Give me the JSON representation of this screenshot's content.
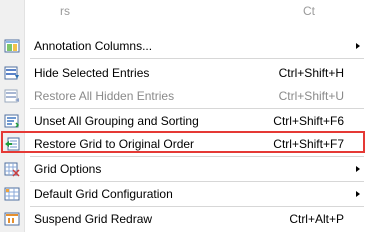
{
  "menu": {
    "partial_top_row": {
      "left_text": "rs",
      "right_text": "Ct"
    },
    "items": [
      {
        "label": "Annotation Columns...",
        "shortcut": "",
        "submenu": true,
        "enabled": true,
        "icon": "annotation-columns-icon"
      },
      {
        "label": "Hide Selected Entries",
        "shortcut": "Ctrl+Shift+H",
        "submenu": false,
        "enabled": true,
        "icon": "hide-entries-icon"
      },
      {
        "label": "Restore All Hidden Entries",
        "shortcut": "Ctrl+Shift+U",
        "submenu": false,
        "enabled": false,
        "icon": "restore-hidden-icon"
      },
      {
        "label": "Unset All Grouping and Sorting",
        "shortcut": "Ctrl+Shift+F6",
        "submenu": false,
        "enabled": true,
        "icon": "unset-grouping-icon"
      },
      {
        "label": "Restore Grid to Original Order",
        "shortcut": "Ctrl+Shift+F7",
        "submenu": false,
        "enabled": true,
        "icon": "restore-grid-icon"
      },
      {
        "label": "Grid Options",
        "shortcut": "",
        "submenu": true,
        "enabled": true,
        "icon": "grid-options-icon"
      },
      {
        "label": "Default Grid Configuration",
        "shortcut": "",
        "submenu": true,
        "enabled": true,
        "icon": "default-grid-icon"
      },
      {
        "label": "Suspend Grid Redraw",
        "shortcut": "Ctrl+Alt+P",
        "submenu": false,
        "enabled": true,
        "icon": "suspend-redraw-icon"
      }
    ]
  },
  "colors": {
    "highlight_border": "#e53935",
    "disabled_text": "#8a8a8a",
    "gutter": "#f0f0f0"
  }
}
